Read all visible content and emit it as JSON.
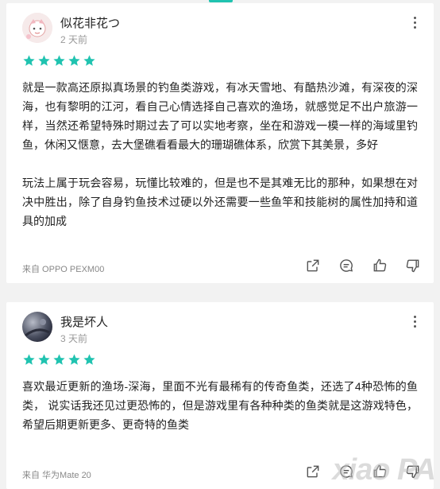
{
  "reviews": [
    {
      "username": "似花非花つ",
      "time": "2 天前",
      "stars": 5,
      "paragraphs": [
        "就是一款高还原拟真场景的钓鱼类游戏，有冰天雪地、有酷热沙滩，有深夜的深海，也有黎明的江河，看自己心情选择自己喜欢的渔场，就感觉足不出户旅游一样，当然还希望特殊时期过去了可以实地考察，坐在和游戏一模一样的海域里钓鱼，休闲又惬意，去大堡礁看看最大的珊瑚礁体系，欣赏下其美景，多好",
        "玩法上属于玩会容易，玩懂比较难的，但是也不是其难无比的那种，如果想在对决中胜出，除了自身钓鱼技术过硬以外还需要一些鱼竿和技能树的属性加持和道具的加成"
      ],
      "device": "来自 OPPO PEXM00"
    },
    {
      "username": "我是坏人",
      "time": "3 天前",
      "stars": 5,
      "paragraphs": [
        "喜欢最近更新的渔场-深海，里面不光有最稀有的传奇鱼类，还选了4种恐怖的鱼类， 说实话我还见过更恐怖的，但是游戏里有各种种类的鱼类就是这游戏特色，希望后期更新更多、更奇特的鱼类"
      ],
      "device": "来自 华为Mate 20"
    }
  ],
  "colors": {
    "star": "#20c3b0",
    "accent": "#20c3b0"
  },
  "watermark": "xiao PA"
}
